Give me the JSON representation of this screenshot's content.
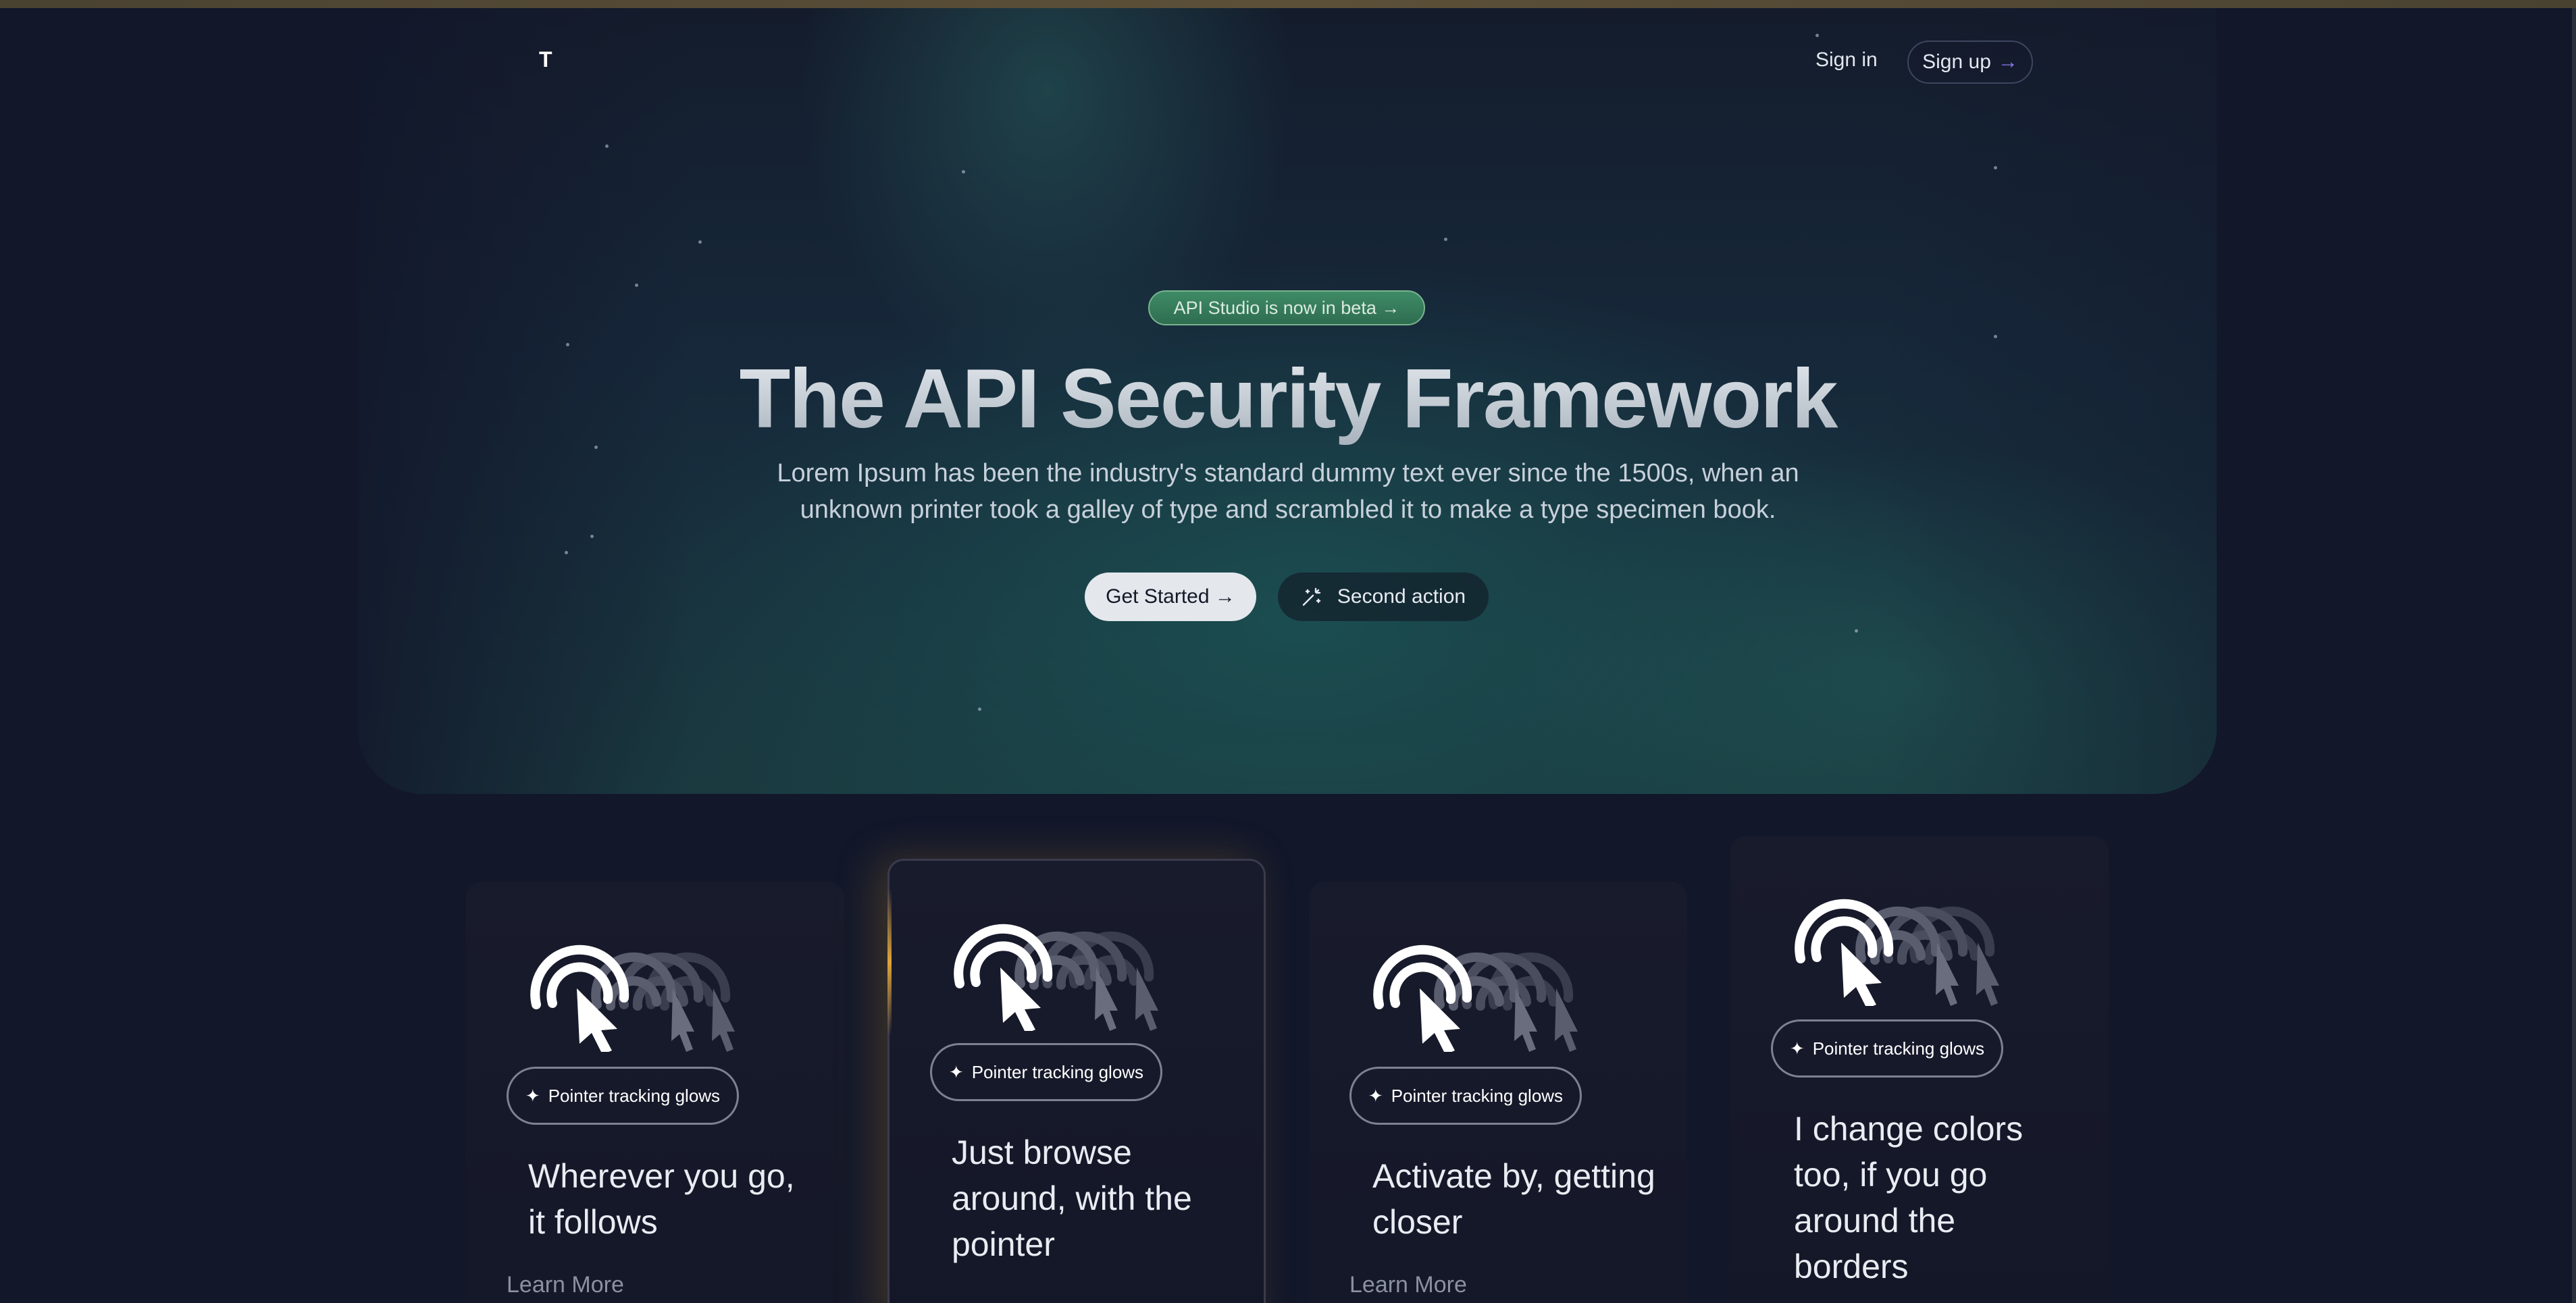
{
  "nav": {
    "logo": "T",
    "signin_label": "Sign in",
    "signup_label": "Sign up",
    "signup_arrow": "→"
  },
  "hero": {
    "badge": "API Studio is now in beta →",
    "title": "The API Security Framework",
    "subtitle": "Lorem Ipsum has been the industry's standard dummy text ever since the 1500s, when an unknown printer took a galley of type and scrambled it to make a type specimen book.",
    "primary_button": "Get Started →",
    "secondary_button": "Second action",
    "secondary_icon": "magic-wand-icon"
  },
  "cards": [
    {
      "chip": "Pointer tracking glows",
      "title": "Wherever you go, it follows",
      "link": "Learn More"
    },
    {
      "chip": "Pointer tracking glows",
      "title": "Just browse around, with the pointer",
      "link": ""
    },
    {
      "chip": "Pointer tracking glows",
      "title": "Activate by, getting closer",
      "link": "Learn More"
    },
    {
      "chip": "Pointer tracking glows",
      "title": "I change colors too, if you go around the borders",
      "link": ""
    }
  ],
  "colors": {
    "background": "#12172a",
    "accent_green": "#3f8b66",
    "accent_purple": "#8f7cf0",
    "glow_amber": "#e0a53a"
  }
}
